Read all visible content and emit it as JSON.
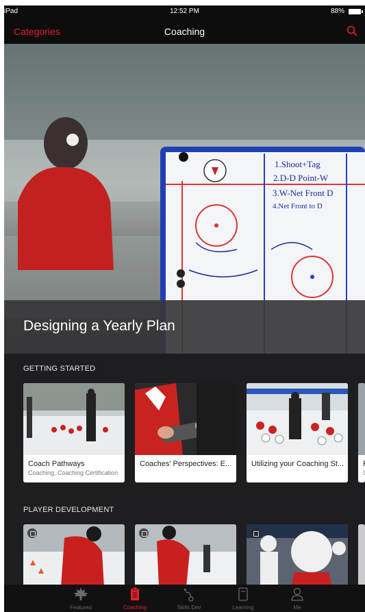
{
  "status_bar": {
    "device": "iPad",
    "time": "12:52 PM",
    "battery": "88%"
  },
  "nav": {
    "left_label": "Categories",
    "title": "Coaching",
    "search_icon": "search-icon"
  },
  "hero": {
    "title": "Designing a Yearly Plan"
  },
  "sections": [
    {
      "title": "GETTING STARTED",
      "cards": [
        {
          "title": "Coach Pathways",
          "subtitle": "Coaching, Coaching Certification"
        },
        {
          "title": "Coaches’ Perspectives: E...",
          "subtitle": ""
        },
        {
          "title": "Utilizing your Coaching St...",
          "subtitle": ""
        },
        {
          "title": "P",
          "subtitle": "C"
        }
      ]
    },
    {
      "title": "PLAYER DEVELOPMENT"
    }
  ],
  "tabs": [
    {
      "label": "Featured",
      "icon": "maple-leaf-icon"
    },
    {
      "label": "Coaching",
      "icon": "clipboard-icon",
      "active": true
    },
    {
      "label": "Skills Dev",
      "icon": "play-diagram-icon"
    },
    {
      "label": "Learning",
      "icon": "book-icon"
    },
    {
      "label": "Me",
      "icon": "person-icon"
    }
  ],
  "colors": {
    "accent": "#e3202b",
    "background": "#1e1e20",
    "bar": "#0d0d0d"
  }
}
